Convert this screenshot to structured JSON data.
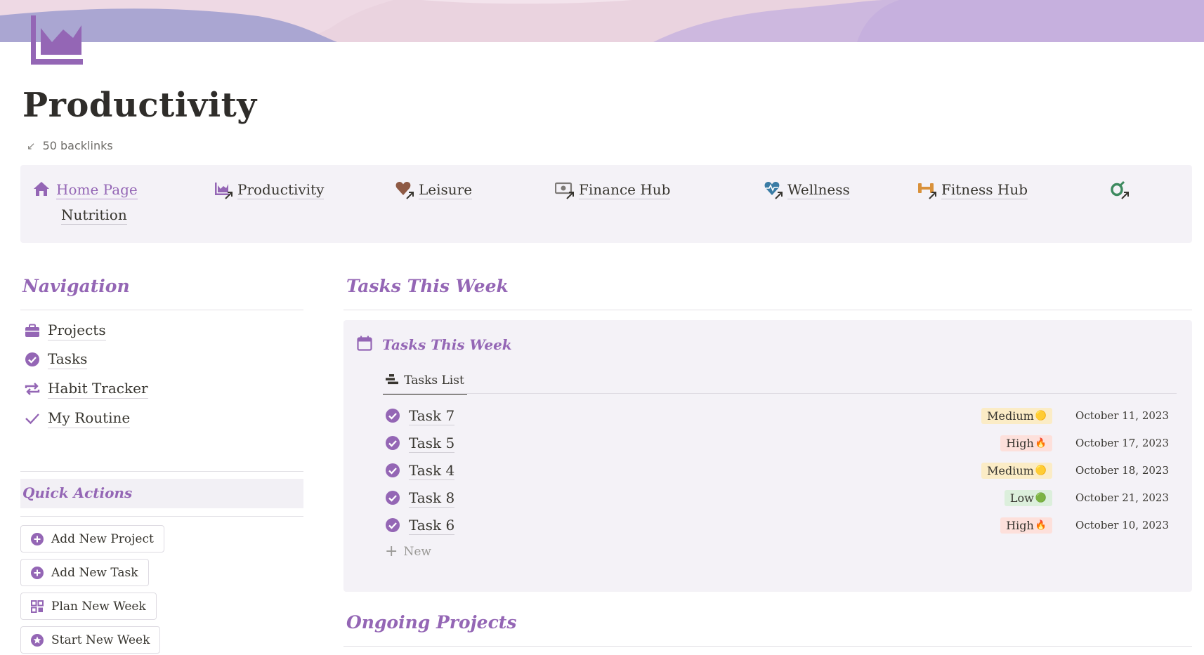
{
  "page": {
    "title": "Productivity",
    "backlinks": "50 backlinks"
  },
  "linkbar": [
    {
      "label": "Home Page",
      "icon": "home-icon"
    },
    {
      "label": "Productivity",
      "icon": "chart-icon"
    },
    {
      "label": "Leisure",
      "icon": "heart-icon"
    },
    {
      "label": "Finance Hub",
      "icon": "money-icon"
    },
    {
      "label": "Wellness",
      "icon": "heartbeat-icon"
    },
    {
      "label": "Fitness Hub",
      "icon": "dumbbell-icon"
    },
    {
      "label": "Nutrition",
      "icon": "avocado-icon"
    }
  ],
  "navigation": {
    "heading": "Navigation",
    "items": [
      {
        "label": "Projects",
        "icon": "briefcase-icon"
      },
      {
        "label": "Tasks",
        "icon": "check-circle-icon"
      },
      {
        "label": "Habit Tracker",
        "icon": "repeat-icon"
      },
      {
        "label": "My Routine",
        "icon": "checkmark-icon"
      }
    ]
  },
  "quick_actions": {
    "heading": "Quick Actions",
    "buttons": [
      {
        "label": "Add New Project",
        "icon": "plus-circle-icon"
      },
      {
        "label": "Add New Task",
        "icon": "plus-circle-icon"
      },
      {
        "label": "Plan New Week",
        "icon": "grid-icon"
      },
      {
        "label": "Start New Week",
        "icon": "star-circle-icon"
      }
    ]
  },
  "tasks_section": {
    "heading": "Tasks This Week",
    "db_title": "Tasks This Week",
    "view_tab": "Tasks List",
    "new_label": "New",
    "rows": [
      {
        "name": "Task 7",
        "priority": "Medium",
        "priority_emoji": "🟡",
        "date": "October 11, 2023"
      },
      {
        "name": "Task 5",
        "priority": "High",
        "priority_emoji": "🔥",
        "date": "October 17, 2023"
      },
      {
        "name": "Task 4",
        "priority": "Medium",
        "priority_emoji": "🟡",
        "date": "October 18, 2023"
      },
      {
        "name": "Task 8",
        "priority": "Low",
        "priority_emoji": "🟢",
        "date": "October 21, 2023"
      },
      {
        "name": "Task 6",
        "priority": "High",
        "priority_emoji": "🔥",
        "date": "October 10, 2023"
      }
    ]
  },
  "ongoing": {
    "heading": "Ongoing Projects"
  },
  "colors": {
    "accent": "#9466b5",
    "medium_bg": "#fbecc6",
    "high_bg": "#fde0db",
    "low_bg": "#dcefdc"
  }
}
